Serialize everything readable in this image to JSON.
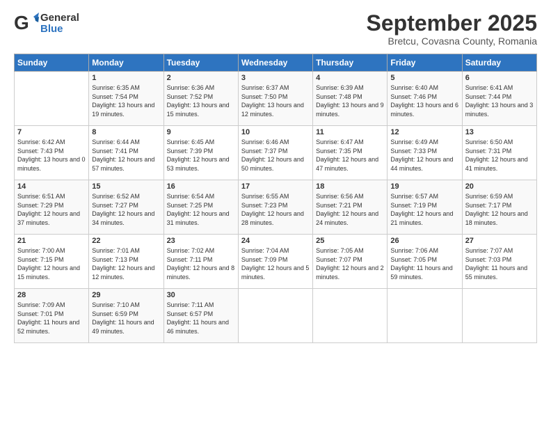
{
  "header": {
    "logo_general": "General",
    "logo_blue": "Blue",
    "month_title": "September 2025",
    "subtitle": "Bretcu, Covasna County, Romania"
  },
  "weekdays": [
    "Sunday",
    "Monday",
    "Tuesday",
    "Wednesday",
    "Thursday",
    "Friday",
    "Saturday"
  ],
  "rows": [
    [
      {
        "day": "",
        "sunrise": "",
        "sunset": "",
        "daylight": ""
      },
      {
        "day": "1",
        "sunrise": "Sunrise: 6:35 AM",
        "sunset": "Sunset: 7:54 PM",
        "daylight": "Daylight: 13 hours and 19 minutes."
      },
      {
        "day": "2",
        "sunrise": "Sunrise: 6:36 AM",
        "sunset": "Sunset: 7:52 PM",
        "daylight": "Daylight: 13 hours and 15 minutes."
      },
      {
        "day": "3",
        "sunrise": "Sunrise: 6:37 AM",
        "sunset": "Sunset: 7:50 PM",
        "daylight": "Daylight: 13 hours and 12 minutes."
      },
      {
        "day": "4",
        "sunrise": "Sunrise: 6:39 AM",
        "sunset": "Sunset: 7:48 PM",
        "daylight": "Daylight: 13 hours and 9 minutes."
      },
      {
        "day": "5",
        "sunrise": "Sunrise: 6:40 AM",
        "sunset": "Sunset: 7:46 PM",
        "daylight": "Daylight: 13 hours and 6 minutes."
      },
      {
        "day": "6",
        "sunrise": "Sunrise: 6:41 AM",
        "sunset": "Sunset: 7:44 PM",
        "daylight": "Daylight: 13 hours and 3 minutes."
      }
    ],
    [
      {
        "day": "7",
        "sunrise": "Sunrise: 6:42 AM",
        "sunset": "Sunset: 7:43 PM",
        "daylight": "Daylight: 13 hours and 0 minutes."
      },
      {
        "day": "8",
        "sunrise": "Sunrise: 6:44 AM",
        "sunset": "Sunset: 7:41 PM",
        "daylight": "Daylight: 12 hours and 57 minutes."
      },
      {
        "day": "9",
        "sunrise": "Sunrise: 6:45 AM",
        "sunset": "Sunset: 7:39 PM",
        "daylight": "Daylight: 12 hours and 53 minutes."
      },
      {
        "day": "10",
        "sunrise": "Sunrise: 6:46 AM",
        "sunset": "Sunset: 7:37 PM",
        "daylight": "Daylight: 12 hours and 50 minutes."
      },
      {
        "day": "11",
        "sunrise": "Sunrise: 6:47 AM",
        "sunset": "Sunset: 7:35 PM",
        "daylight": "Daylight: 12 hours and 47 minutes."
      },
      {
        "day": "12",
        "sunrise": "Sunrise: 6:49 AM",
        "sunset": "Sunset: 7:33 PM",
        "daylight": "Daylight: 12 hours and 44 minutes."
      },
      {
        "day": "13",
        "sunrise": "Sunrise: 6:50 AM",
        "sunset": "Sunset: 7:31 PM",
        "daylight": "Daylight: 12 hours and 41 minutes."
      }
    ],
    [
      {
        "day": "14",
        "sunrise": "Sunrise: 6:51 AM",
        "sunset": "Sunset: 7:29 PM",
        "daylight": "Daylight: 12 hours and 37 minutes."
      },
      {
        "day": "15",
        "sunrise": "Sunrise: 6:52 AM",
        "sunset": "Sunset: 7:27 PM",
        "daylight": "Daylight: 12 hours and 34 minutes."
      },
      {
        "day": "16",
        "sunrise": "Sunrise: 6:54 AM",
        "sunset": "Sunset: 7:25 PM",
        "daylight": "Daylight: 12 hours and 31 minutes."
      },
      {
        "day": "17",
        "sunrise": "Sunrise: 6:55 AM",
        "sunset": "Sunset: 7:23 PM",
        "daylight": "Daylight: 12 hours and 28 minutes."
      },
      {
        "day": "18",
        "sunrise": "Sunrise: 6:56 AM",
        "sunset": "Sunset: 7:21 PM",
        "daylight": "Daylight: 12 hours and 24 minutes."
      },
      {
        "day": "19",
        "sunrise": "Sunrise: 6:57 AM",
        "sunset": "Sunset: 7:19 PM",
        "daylight": "Daylight: 12 hours and 21 minutes."
      },
      {
        "day": "20",
        "sunrise": "Sunrise: 6:59 AM",
        "sunset": "Sunset: 7:17 PM",
        "daylight": "Daylight: 12 hours and 18 minutes."
      }
    ],
    [
      {
        "day": "21",
        "sunrise": "Sunrise: 7:00 AM",
        "sunset": "Sunset: 7:15 PM",
        "daylight": "Daylight: 12 hours and 15 minutes."
      },
      {
        "day": "22",
        "sunrise": "Sunrise: 7:01 AM",
        "sunset": "Sunset: 7:13 PM",
        "daylight": "Daylight: 12 hours and 12 minutes."
      },
      {
        "day": "23",
        "sunrise": "Sunrise: 7:02 AM",
        "sunset": "Sunset: 7:11 PM",
        "daylight": "Daylight: 12 hours and 8 minutes."
      },
      {
        "day": "24",
        "sunrise": "Sunrise: 7:04 AM",
        "sunset": "Sunset: 7:09 PM",
        "daylight": "Daylight: 12 hours and 5 minutes."
      },
      {
        "day": "25",
        "sunrise": "Sunrise: 7:05 AM",
        "sunset": "Sunset: 7:07 PM",
        "daylight": "Daylight: 12 hours and 2 minutes."
      },
      {
        "day": "26",
        "sunrise": "Sunrise: 7:06 AM",
        "sunset": "Sunset: 7:05 PM",
        "daylight": "Daylight: 11 hours and 59 minutes."
      },
      {
        "day": "27",
        "sunrise": "Sunrise: 7:07 AM",
        "sunset": "Sunset: 7:03 PM",
        "daylight": "Daylight: 11 hours and 55 minutes."
      }
    ],
    [
      {
        "day": "28",
        "sunrise": "Sunrise: 7:09 AM",
        "sunset": "Sunset: 7:01 PM",
        "daylight": "Daylight: 11 hours and 52 minutes."
      },
      {
        "day": "29",
        "sunrise": "Sunrise: 7:10 AM",
        "sunset": "Sunset: 6:59 PM",
        "daylight": "Daylight: 11 hours and 49 minutes."
      },
      {
        "day": "30",
        "sunrise": "Sunrise: 7:11 AM",
        "sunset": "Sunset: 6:57 PM",
        "daylight": "Daylight: 11 hours and 46 minutes."
      },
      {
        "day": "",
        "sunrise": "",
        "sunset": "",
        "daylight": ""
      },
      {
        "day": "",
        "sunrise": "",
        "sunset": "",
        "daylight": ""
      },
      {
        "day": "",
        "sunrise": "",
        "sunset": "",
        "daylight": ""
      },
      {
        "day": "",
        "sunrise": "",
        "sunset": "",
        "daylight": ""
      }
    ]
  ]
}
